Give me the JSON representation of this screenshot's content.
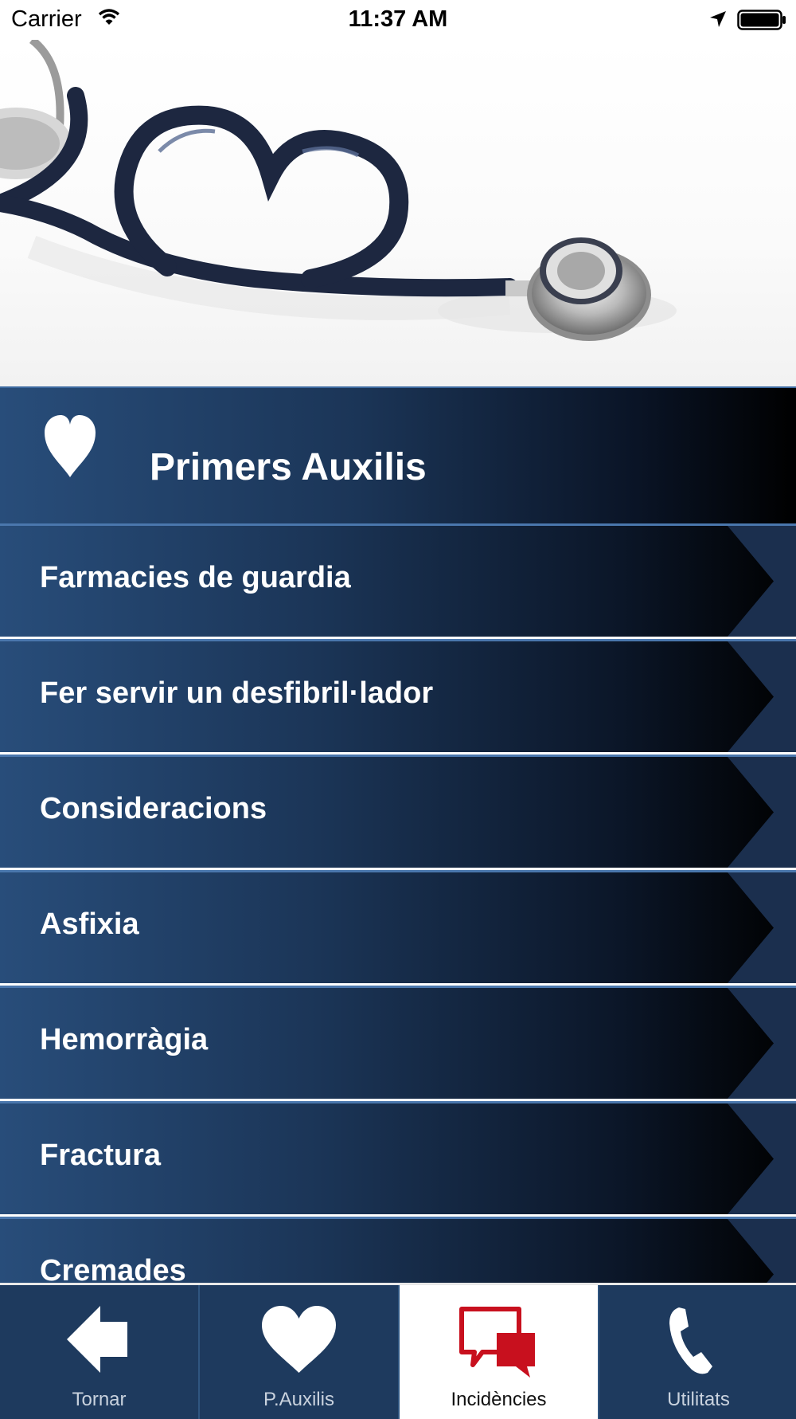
{
  "status_bar": {
    "carrier": "Carrier",
    "time": "11:37 AM"
  },
  "header": {
    "title": "Primers Auxilis",
    "icon": "heart-icon"
  },
  "menu": {
    "items": [
      {
        "label": "Farmacies de guardia"
      },
      {
        "label": "Fer servir un desfibril·lador"
      },
      {
        "label": "Consideracions"
      },
      {
        "label": "Asfixia"
      },
      {
        "label": "Hemorràgia"
      },
      {
        "label": "Fractura"
      },
      {
        "label": "Cremades"
      }
    ]
  },
  "tab_bar": {
    "tabs": [
      {
        "label": "Tornar",
        "icon": "back-arrow-icon",
        "active": false
      },
      {
        "label": "P.Auxilis",
        "icon": "heart-icon",
        "active": false
      },
      {
        "label": "Incidències",
        "icon": "chat-bubbles-icon",
        "active": true
      },
      {
        "label": "Utilitats",
        "icon": "phone-icon",
        "active": false
      }
    ]
  },
  "colors": {
    "brand_blue": "#1e3a5e",
    "accent_red": "#c8101e"
  }
}
